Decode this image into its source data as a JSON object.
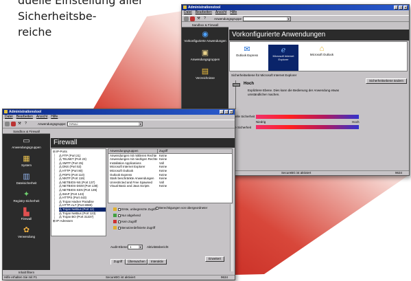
{
  "intro_text": {
    "line1": "duelle Einstellung aller",
    "line2": "Sicherheitsbe-",
    "line3": "reiche"
  },
  "colors": {
    "titlebar": "#0a2a8c",
    "side_panel": "#2b2b2b",
    "ramp_red": "#c4251e",
    "selection": "#0a246a"
  },
  "win1": {
    "title": "Administrationstool",
    "menu": [
      "Datei",
      "Bearbeiten",
      "Ansicht",
      "Hilfe"
    ],
    "group_label": "Anwendungsgruppe",
    "side_title": "Sandbox & Firewall",
    "side_items": [
      {
        "label": "Vorkonfigurierte Anwendungen",
        "icon": "globe-icon"
      },
      {
        "label": "Anwendungsgruppen",
        "icon": "app-group-icon"
      },
      {
        "label": "Verzeichnisse",
        "icon": "folder-icon"
      }
    ],
    "header": "Vorkonfigurierte Anwendungen",
    "apps": [
      {
        "label": "Outlook Express",
        "icon": "outlook-express-icon"
      },
      {
        "label": "Microsoft Internet Explorer",
        "icon": "internet-explorer-icon"
      },
      {
        "label": "Microsoft Outlook",
        "icon": "outlook-icon"
      }
    ],
    "level_title": "Sicherheitsebene für Microsoft Internet Explorer",
    "level_button": "Sicherheitsebene ändern",
    "level_name": "Hoch",
    "level_desc": "Explizitere Ebene. Dies kann die Bedienung der Anwendung etwas umständlicher machen.",
    "current_label": "Aktuelle Sicherheit",
    "new_label": "Neue Sicherheit",
    "low": "Niedrig",
    "high": "Hoch",
    "status_center": "SecureBG ist aktiviert",
    "status_right": "9634"
  },
  "win2": {
    "title": "Administrationstool",
    "menu": [
      "Datei",
      "Bearbeiten",
      "Ansicht",
      "Hilfe"
    ],
    "group_label": "Anwendungsgruppe:",
    "group_value": "HALLi",
    "side_title": "Sandbox & Firewall",
    "side_items": [
      {
        "label": "Anwendungsgruppen",
        "icon": "monitor-icon"
      },
      {
        "label": "System",
        "icon": "system-icon"
      },
      {
        "label": "Dateisicherheit",
        "icon": "file-security-icon"
      },
      {
        "label": "Registry-Sicherheit",
        "icon": "registry-icon"
      },
      {
        "label": "Firewall",
        "icon": "firewall-icon"
      },
      {
        "label": "Verwendung",
        "icon": "usage-icon"
      }
    ],
    "side_bottom": "Inhalt filtern",
    "header": "Firewall",
    "tree_root": "IP-Ports",
    "tree": [
      "FTP (Port 21)",
      "TELNET (Port 23)",
      "SMTP (Port 25)",
      "DNS (Port 53)",
      "HTTP (Port 80)",
      "POP3 (Port 110)",
      "NNTP (Port 119)",
      "NETBIOS-NS (Port 137)",
      "NETBIOS-DGM (Port 138)",
      "NETBIOS-SSN (Port 139)",
      "IMAP (Port 143)",
      "HTTPS (Port 443)",
      "Trojan Hacker Paradise",
      "HTTP-ALT (Port 8080)",
      "Trojan NetBus (Port 12)",
      "Trojan NetBus (Port 123)",
      "Trojan BO (Port 31337)"
    ],
    "tree_root2": "IP-Adressen",
    "tree_selected": 14,
    "list_headers": [
      "Anwendungsgruppen",
      "Zugriff"
    ],
    "list": [
      [
        "Anwendungen mit mittleren Rechte",
        "Keine"
      ],
      [
        "Anwendungen mit niedrigen Rechte",
        "Keine"
      ],
      [
        "Installation Applications",
        "Voll"
      ],
      [
        "Microsoft Internet Explorer",
        "Keine"
      ],
      [
        "Microsoft Outlook",
        "Keine"
      ],
      [
        "Outlook Express",
        "Keine"
      ],
      [
        "Stark beschränkte Anwendungen",
        "Keine"
      ],
      [
        "Unrestricted and Free Spawned",
        "Voll"
      ],
      [
        "Visual Basic and Java Scripts",
        "Keine"
      ]
    ],
    "options": [
      "Erste, unbegrenzte Zugriff",
      "Nur abgehend",
      "Kein Zugriff",
      "Benutzerdefinierte Zugriff"
    ],
    "option_right": "Berechtigungen von übergeordneter",
    "level_label": "Audit-Ebene",
    "level_value": "1",
    "active_label": "Aktivitätsbericht",
    "tabs": [
      "Zugriff",
      "Überwachen",
      "Interaktiv"
    ],
    "button": "Erweitert",
    "status_left": "Hilfe erhalten Sie mit F1",
    "status_center": "SecureBG ist aktiviert",
    "status_right": "9634"
  }
}
